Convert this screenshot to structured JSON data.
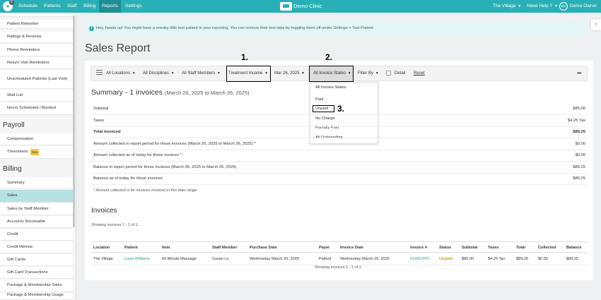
{
  "nav": {
    "logo_badge": "8",
    "items": [
      "Schedule",
      "Patients",
      "Staff",
      "Billing",
      "Reports",
      "Settings"
    ],
    "clinic_name": "Demo Clinic",
    "location": "The Village",
    "help": "Need Help ?",
    "avatar_initials": "DO",
    "user": "Demo Owner"
  },
  "sidebar": {
    "items_top": [
      "Patient Retention",
      "Ratings & Reviews",
      "Phone Reminders",
      "Return Visit Reminders",
      "Unscheduled Patients (Last Visit)",
      "Wait List",
      "Hours Scheduled / Booked"
    ],
    "payroll_heading": "Payroll",
    "payroll_items": [
      "Compensation",
      "Timesheets"
    ],
    "new_badge": "New",
    "billing_heading": "Billing",
    "billing_items": [
      "Summary",
      "Sales",
      "Sales by Staff Member",
      "Accounts Receivable",
      "Credit",
      "Credit Memos",
      "Gift Cards",
      "Gift Card Transactions",
      "Package & Membership Sales",
      "Package & Membership Usage"
    ]
  },
  "banner": {
    "text": "Hey, heads up! You might have a sneaky little test patient in your reporting. You can remove their test data by toggling them off under Settings > Test Patient"
  },
  "page_title": "Sales Report",
  "filters": {
    "locations": "All Locations",
    "disciplines": "All Disciplines",
    "staff": "All Staff Members",
    "income": "Treatment Income",
    "date": "Mar 26, 2025",
    "invoice_states": "All Invoice States",
    "filter_by": "Filter By",
    "detail": "Detail",
    "reset": "Reset"
  },
  "annotations": [
    "1.",
    "2.",
    "3."
  ],
  "dropdown": [
    "All Invoice States",
    "Paid",
    "Unpaid",
    "No Charge",
    "Partially Paid",
    "All Outstanding"
  ],
  "summary": {
    "title": "Summary - 1 invoices",
    "date_range": "(March 26, 2025 to March 26, 2025)",
    "rows": [
      {
        "label": "Subtotal",
        "value": "$85.00"
      },
      {
        "label": "Taxes",
        "value": "$4.25 Tax"
      },
      {
        "label": "Total Invoiced",
        "value": "$89.25"
      },
      {
        "label": "Amount collected in report period for these invoices (March 26, 2025 to March 26, 2025) *",
        "value": "$0.00"
      },
      {
        "label": "Amount collected as of today for these invoices *",
        "value": "$0.00"
      },
      {
        "label": "Balance in report period for these invoices (March 26, 2025 to March 26, 2025)",
        "value": "$89.25"
      },
      {
        "label": "Balance as of today for these invoices",
        "value": "$89.25"
      }
    ],
    "note": "* Amount collected is for invoices invoiced in this date range."
  },
  "invoices": {
    "title": "Invoices",
    "showing_top": "Showing invoices 1 - 1 of 1",
    "showing_bottom": "Showing invoices 1 - 1 of 1",
    "headers": [
      "Location",
      "Patient",
      "Item",
      "Staff Member",
      "Purchase Date",
      "Payer",
      "Invoice Date",
      "Invoice #",
      "Status",
      "Subtotal",
      "Taxes",
      "Total",
      "Collected",
      "Balance"
    ],
    "row": [
      "The Village",
      "Louis Williams",
      "60 Minute Massage",
      "Susan Lo",
      "Wednesday March 26, 2025",
      "Patient",
      "Wednesday March 26, 2025",
      "#1955-P01",
      "Unpaid",
      "$85.00",
      "$4.25 Tax",
      "$89.25",
      "$0.00",
      "$89.25"
    ]
  }
}
